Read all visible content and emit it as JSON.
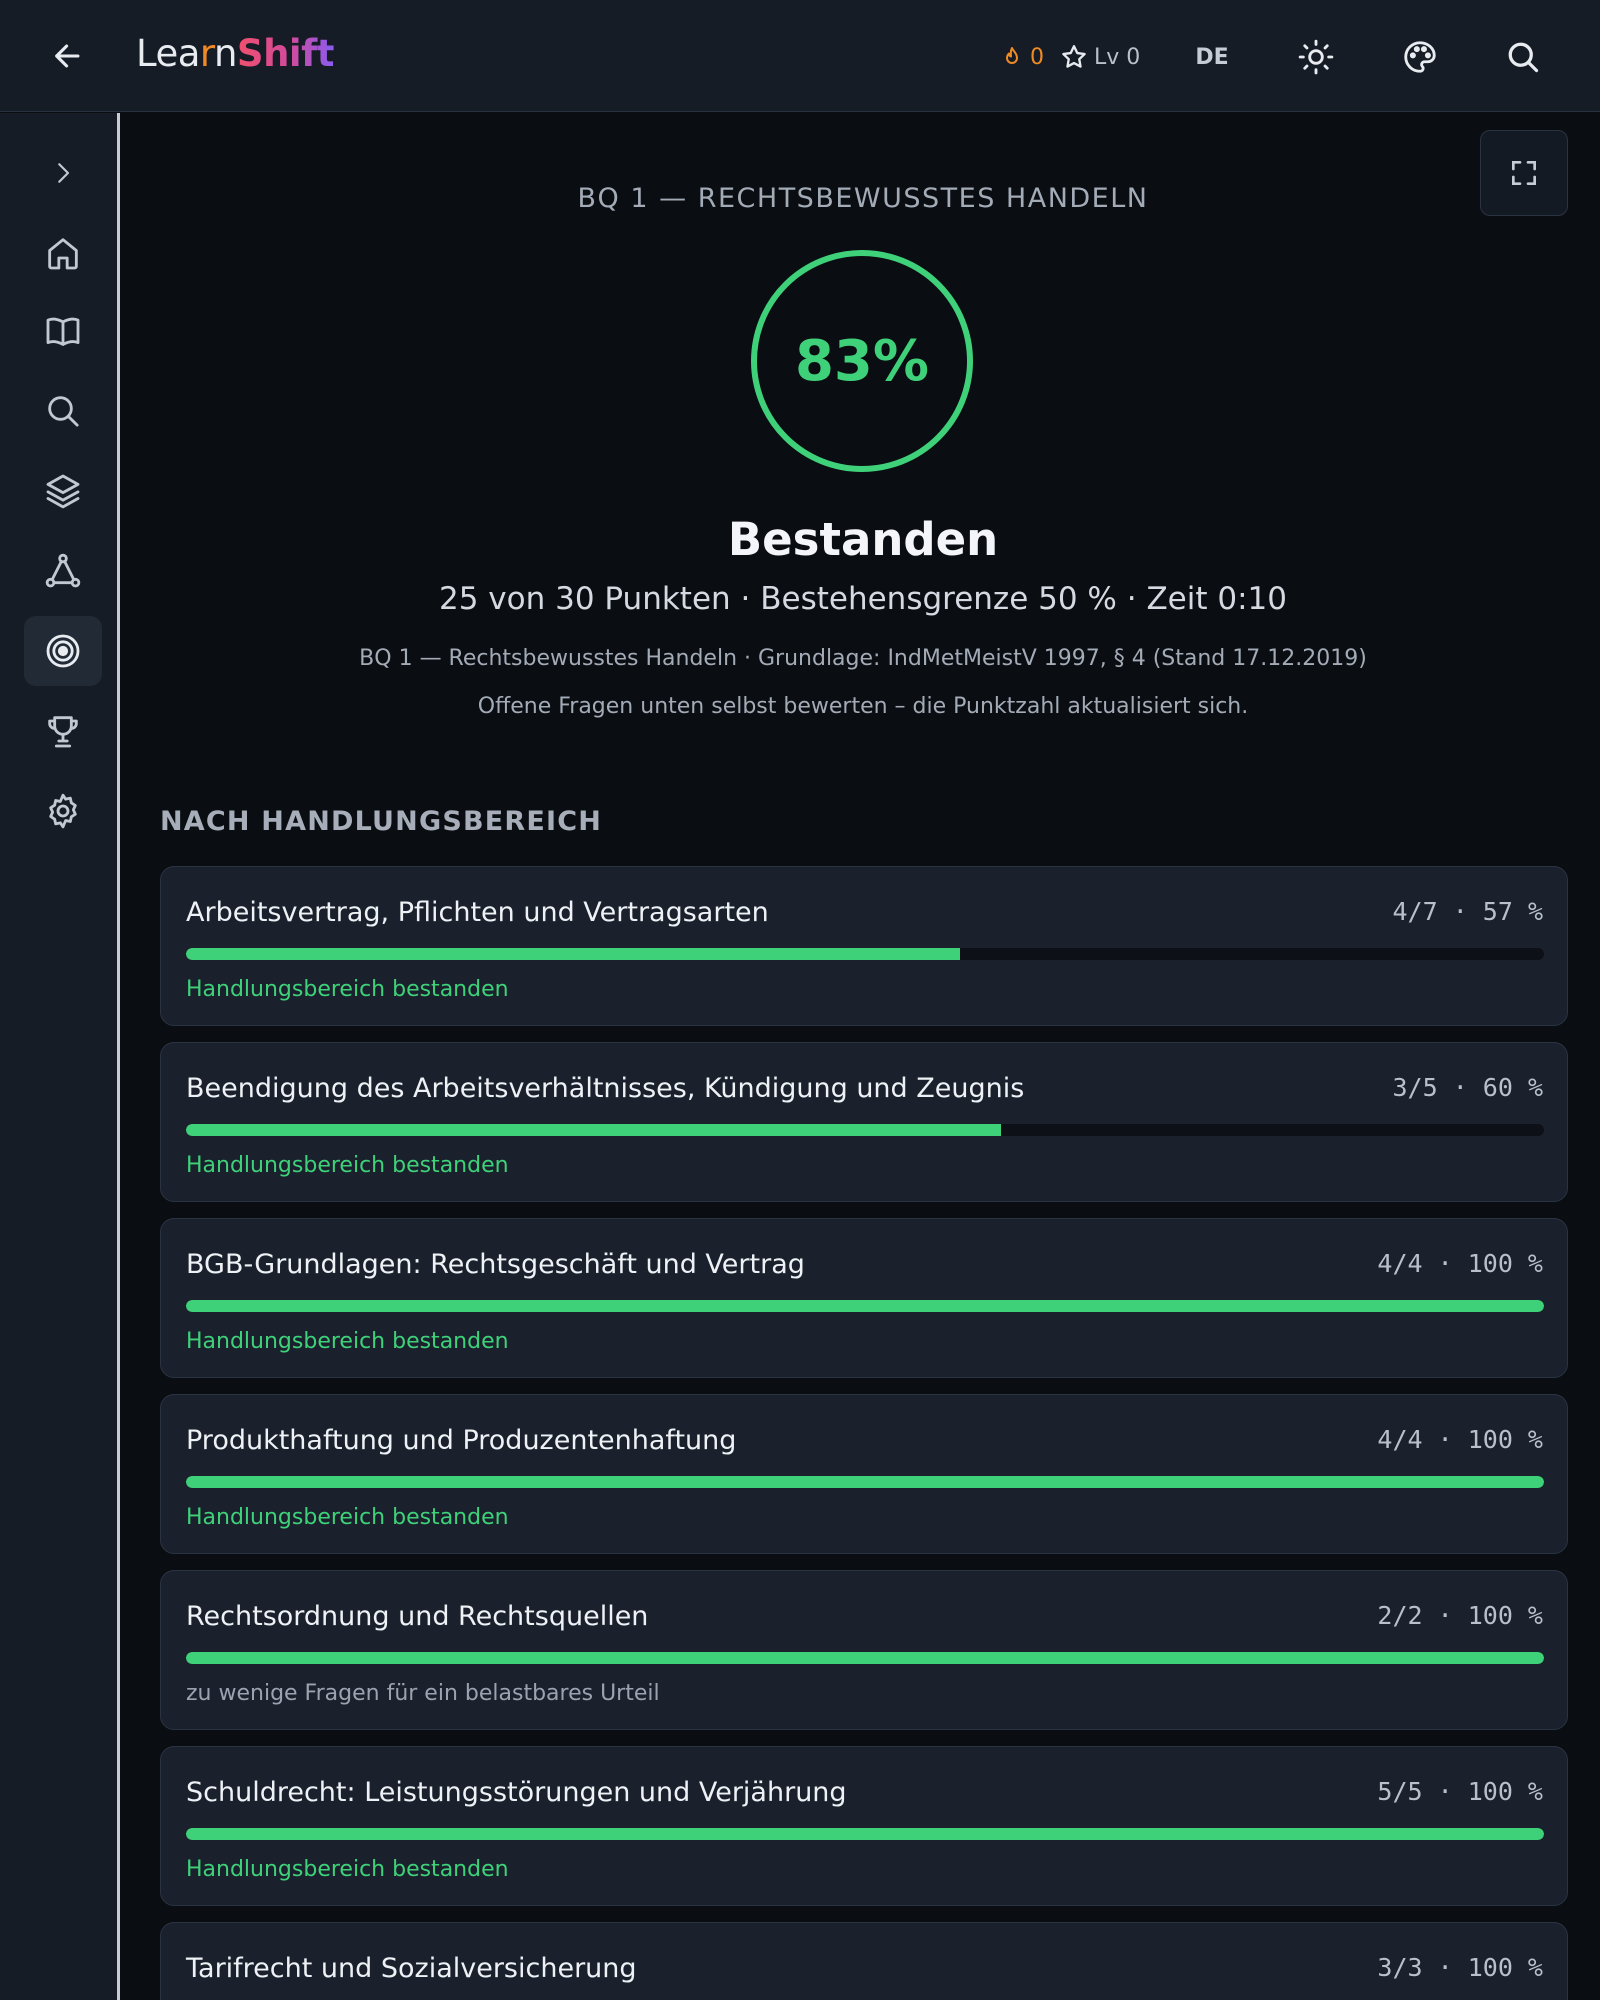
{
  "app": {
    "logo_learn_pre": "Lea",
    "logo_learn_r": "r",
    "logo_learn_post": "n",
    "logo_shift": "Shift"
  },
  "topbar": {
    "streak_count": "0",
    "level_label": "Lv 0",
    "language": "DE",
    "icons": [
      "back-arrow-icon",
      "flame-icon",
      "star-icon",
      "sun-icon",
      "palette-icon",
      "search-icon"
    ]
  },
  "sidebar": {
    "items": [
      {
        "icon": "chevron-right-icon"
      },
      {
        "icon": "home-icon"
      },
      {
        "icon": "book-icon"
      },
      {
        "icon": "search-icon"
      },
      {
        "icon": "layers-icon"
      },
      {
        "icon": "graph-icon"
      },
      {
        "icon": "target-icon",
        "active": true
      },
      {
        "icon": "trophy-icon"
      },
      {
        "icon": "gear-icon"
      }
    ]
  },
  "result": {
    "exam_title": "BQ 1 — RECHTSBEWUSSTES HANDELN",
    "score_percent": "83%",
    "score_fraction": 0.83,
    "verdict": "Bestanden",
    "summary": "25 von 30 Punkten · Bestehensgrenze 50 % · Zeit 0:10",
    "basis": "BQ 1 — Rechtsbewusstes Handeln · Grundlage: IndMetMeistV 1997, § 4 (Stand 17.12.2019)",
    "hint": "Offene Fragen unten selbst bewerten – die Punktzahl aktualisiert sich."
  },
  "areas_heading": "NACH HANDLUNGSBEREICH",
  "areas": [
    {
      "name": "Arbeitsvertrag, Pflichten und Vertragsarten",
      "stats": "4/7 · 57 %",
      "progress": 0.57,
      "verdict": "Handlungsbereich bestanden",
      "verdict_type": "passed"
    },
    {
      "name": "Beendigung des Arbeitsverhältnisses, Kündigung und Zeugnis",
      "stats": "3/5 · 60 %",
      "progress": 0.6,
      "verdict": "Handlungsbereich bestanden",
      "verdict_type": "passed"
    },
    {
      "name": "BGB-Grundlagen: Rechtsgeschäft und Vertrag",
      "stats": "4/4 · 100 %",
      "progress": 1.0,
      "verdict": "Handlungsbereich bestanden",
      "verdict_type": "passed"
    },
    {
      "name": "Produkthaftung und Produzentenhaftung",
      "stats": "4/4 · 100 %",
      "progress": 1.0,
      "verdict": "Handlungsbereich bestanden",
      "verdict_type": "passed"
    },
    {
      "name": "Rechtsordnung und Rechtsquellen",
      "stats": "2/2 · 100 %",
      "progress": 1.0,
      "verdict": "zu wenige Fragen für ein belastbares Urteil",
      "verdict_type": "neutral"
    },
    {
      "name": "Schuldrecht: Leistungsstörungen und Verjährung",
      "stats": "5/5 · 100 %",
      "progress": 1.0,
      "verdict": "Handlungsbereich bestanden",
      "verdict_type": "passed"
    },
    {
      "name": "Tarifrecht und Sozialversicherung",
      "stats": "3/3 · 100 %",
      "progress": 1.0,
      "verdict": "",
      "verdict_type": "passed"
    }
  ],
  "colors": {
    "accent_green": "#3fd17a",
    "streak_orange": "#f08a24",
    "background": "#0a0d12",
    "card": "#1a212c"
  }
}
